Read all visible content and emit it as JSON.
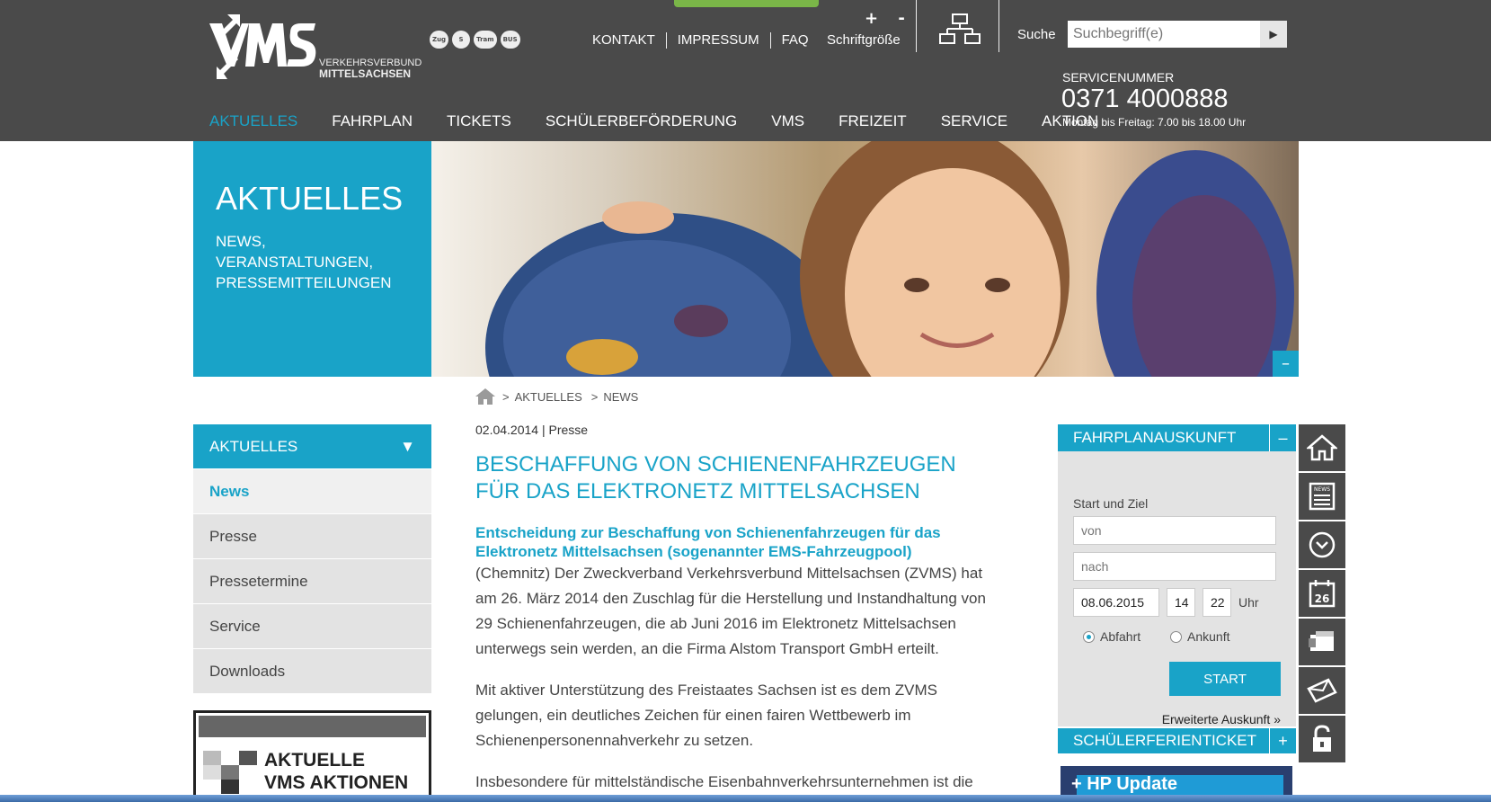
{
  "header": {
    "logo_text_top": "VERKEHRSVERBUND",
    "logo_text_bottom": "MITTELSACHSEN",
    "transport_icons": [
      "Zug",
      "S",
      "Tram",
      "BUS"
    ],
    "top_links": [
      "KONTAKT",
      "IMPRESSUM",
      "FAQ"
    ],
    "fontsize_controls": "+ -",
    "fontsize_label": "Schriftgröße",
    "search_label": "Suche",
    "search_placeholder": "Suchbegriff(e)",
    "service_label": "SERVICENUMMER",
    "service_number": "0371 4000888",
    "service_hours": "Montag bis Freitag: 7.00 bis 18.00 Uhr",
    "colors": {
      "bg": "#4a4a4a",
      "accent": "#19a3c8"
    }
  },
  "mainnav": [
    {
      "label": "AKTUELLES",
      "active": true
    },
    {
      "label": "FAHRPLAN",
      "active": false
    },
    {
      "label": "TICKETS",
      "active": false
    },
    {
      "label": "SCHÜLERBEFÖRDERUNG",
      "active": false
    },
    {
      "label": "VMS",
      "active": false
    },
    {
      "label": "FREIZEIT",
      "active": false
    },
    {
      "label": "SERVICE",
      "active": false
    },
    {
      "label": "AKTION",
      "active": false
    }
  ],
  "hero": {
    "title": "AKTUELLES",
    "subtitle": "NEWS,\nVERANSTALTUNGEN,\nPRESSEMITTEILUNGEN",
    "collapse": "–"
  },
  "breadcrumb": [
    "AKTUELLES",
    "NEWS"
  ],
  "sidenav": {
    "head": "AKTUELLES",
    "items": [
      {
        "label": "News",
        "active": true
      },
      {
        "label": "Presse",
        "active": false
      },
      {
        "label": "Pressetermine",
        "active": false
      },
      {
        "label": "Service",
        "active": false
      },
      {
        "label": "Downloads",
        "active": false
      }
    ]
  },
  "promo": {
    "line1": "AKTUELLE",
    "line2": "VMS AKTIONEN"
  },
  "article": {
    "meta": "02.04.2014 | Presse",
    "title": "BESCHAFFUNG VON SCHIENENFAHRZEUGEN FÜR DAS ELEKTRONETZ MITTELSACHSEN",
    "lead": "Entscheidung zur Beschaffung von Schienenfahrzeugen für das Elektronetz Mittelsachsen (sogenannter EMS-Fahrzeugpool)",
    "paragraphs": [
      "(Chemnitz) Der Zweckverband Verkehrsverbund Mittelsachsen (ZVMS) hat am 26. März 2014 den Zuschlag für die  Herstellung und Instandhaltung von 29 Schienenfahrzeugen, die ab Juni 2016 im Elektronetz Mittelsachsen unterwegs sein werden, an die Firma Alstom Transport GmbH erteilt.",
      "Mit aktiver Unterstützung des Freistaates Sachsen ist es dem ZVMS gelungen, ein deutliches Zeichen für einen fairen Wettbewerb im Schienenpersonennahverkehr zu setzen.",
      "Insbesondere für mittelständische Eisenbahnverkehrsunternehmen ist die"
    ]
  },
  "widget": {
    "head": "FAHRPLANAUSKUNFT",
    "toggle": "–",
    "label": "Start und Ziel",
    "from_placeholder": "von",
    "to_placeholder": "nach",
    "date": "08.06.2015",
    "hour": "14",
    "minute": "22",
    "time_unit": "Uhr",
    "radio_departure": "Abfahrt",
    "radio_arrival": "Ankunft",
    "start": "START",
    "more": "Erweiterte Auskunft »"
  },
  "widget2": {
    "head": "SCHÜLERFERIENTICKET",
    "toggle": "+"
  },
  "banner": {
    "text": "+ HP Update"
  },
  "iconstrip": [
    "home-icon",
    "news-icon",
    "chevron-down-circle-icon",
    "calendar-icon",
    "ticket-icon",
    "mail-icon",
    "lock-icon"
  ],
  "iconstrip_calendar_day": "26",
  "iconstrip_news_label": "NEWS"
}
